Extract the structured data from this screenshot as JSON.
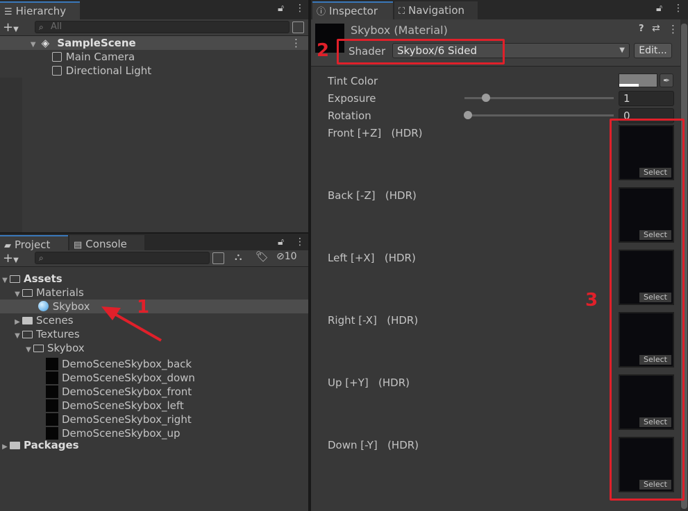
{
  "hierarchy": {
    "tab_label": "Hierarchy",
    "search_placeholder": "All",
    "scene": "SampleScene",
    "items": [
      "Main Camera",
      "Directional Light"
    ]
  },
  "project": {
    "tabs": [
      "Project",
      "Console"
    ],
    "hidden_count": "10",
    "tree": {
      "assets": "Assets",
      "materials": "Materials",
      "skybox_material": "Skybox",
      "scenes": "Scenes",
      "textures": "Textures",
      "skybox_folder": "Skybox",
      "textures_list": [
        "DemoSceneSkybox_back",
        "DemoSceneSkybox_down",
        "DemoSceneSkybox_front",
        "DemoSceneSkybox_left",
        "DemoSceneSkybox_right",
        "DemoSceneSkybox_up"
      ],
      "packages": "Packages"
    }
  },
  "inspector": {
    "tabs": [
      "Inspector",
      "Navigation"
    ],
    "title": "Skybox (Material)",
    "shader_label": "Shader",
    "shader_value": "Skybox/6 Sided",
    "edit_button": "Edit...",
    "tint_label": "Tint Color",
    "exposure_label": "Exposure",
    "exposure_value": "1",
    "rotation_label": "Rotation",
    "rotation_value": "0",
    "textures": [
      {
        "label": "Front [+Z]   (HDR)",
        "select": "Select"
      },
      {
        "label": "Back [-Z]   (HDR)",
        "select": "Select"
      },
      {
        "label": "Left [+X]   (HDR)",
        "select": "Select"
      },
      {
        "label": "Right [-X]   (HDR)",
        "select": "Select"
      },
      {
        "label": "Up [+Y]   (HDR)",
        "select": "Select"
      },
      {
        "label": "Down [-Y]   (HDR)",
        "select": "Select"
      }
    ]
  },
  "annotations": {
    "callout1": "1",
    "callout2": "2",
    "callout3": "3",
    "color": "#e0202a"
  }
}
